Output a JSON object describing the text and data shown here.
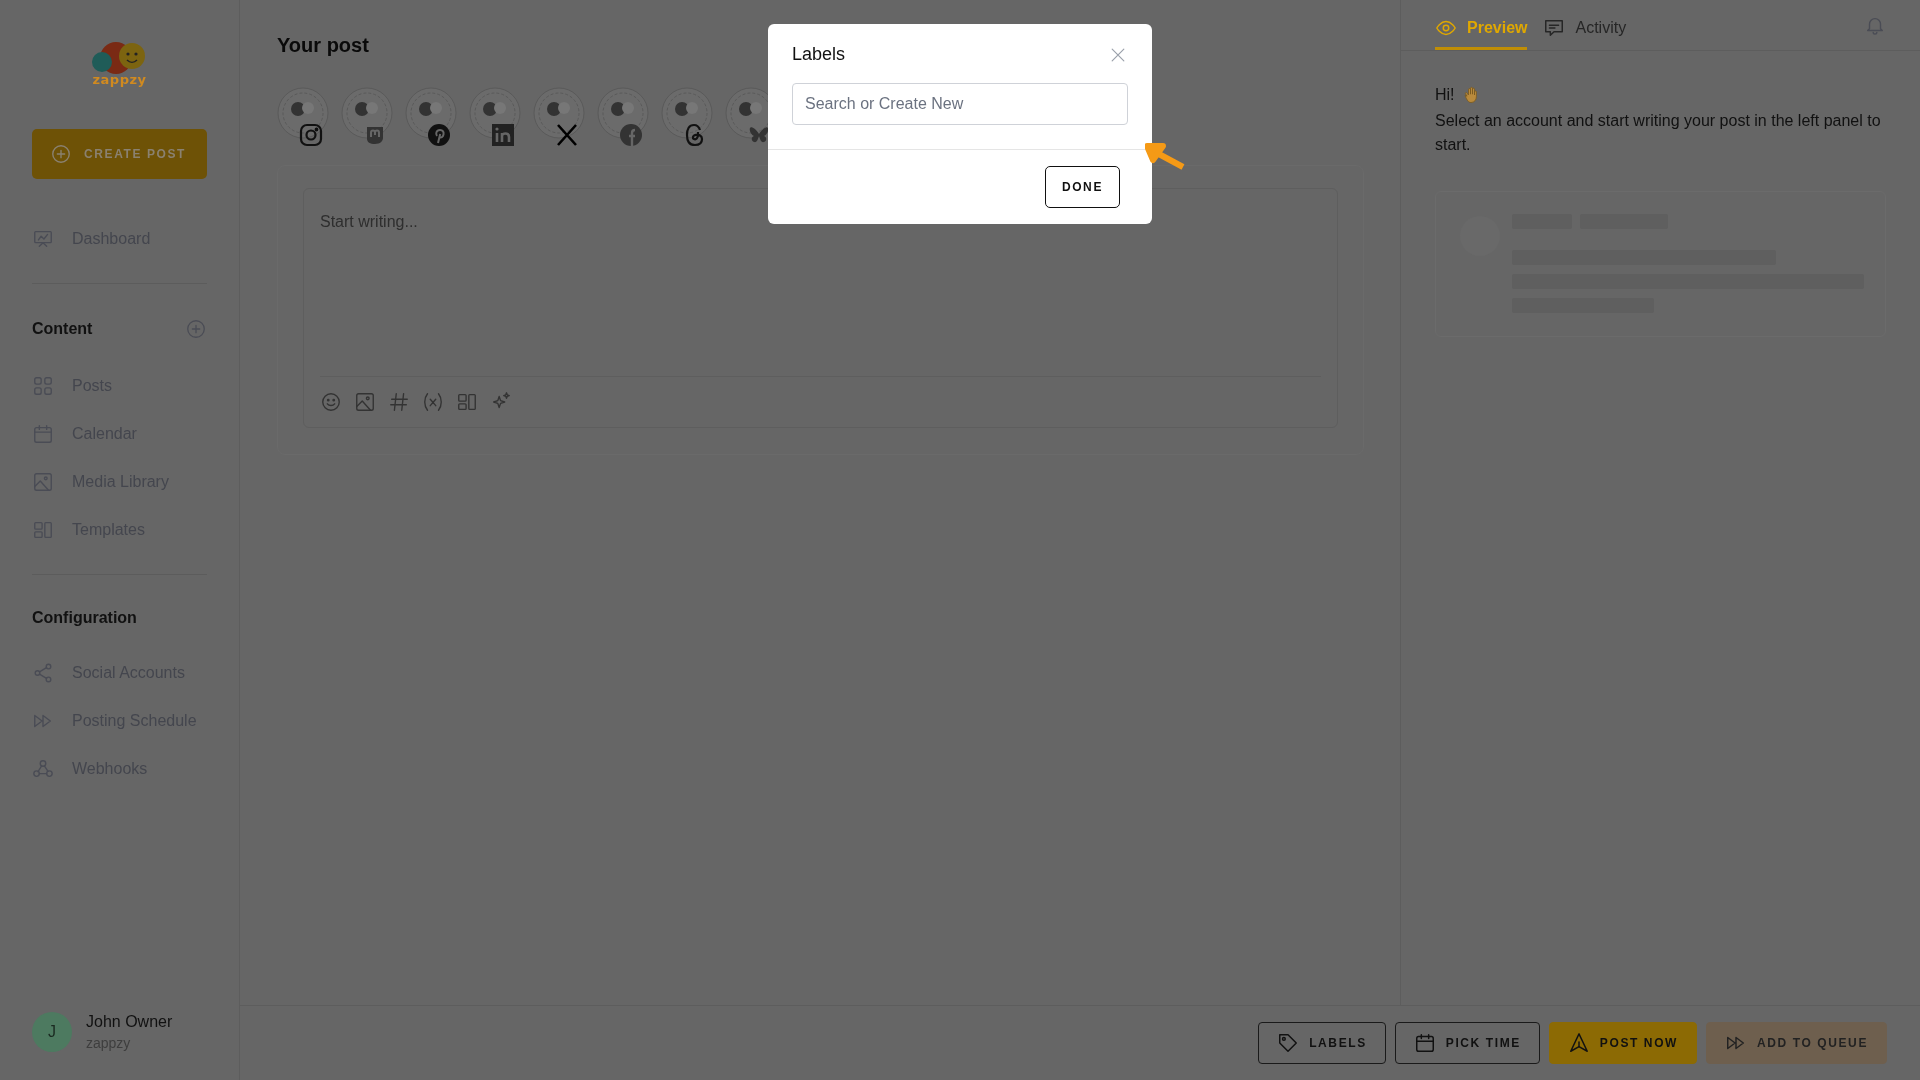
{
  "sidebar": {
    "logo_text": "zappzy",
    "create_button": "CREATE POST",
    "top_items": [
      {
        "label": "Dashboard"
      }
    ],
    "sections": [
      {
        "title": "Content",
        "add_button": true,
        "items": [
          {
            "label": "Posts"
          },
          {
            "label": "Calendar"
          },
          {
            "label": "Media Library"
          },
          {
            "label": "Templates"
          }
        ]
      },
      {
        "title": "Configuration",
        "add_button": false,
        "items": [
          {
            "label": "Social Accounts"
          },
          {
            "label": "Posting Schedule"
          },
          {
            "label": "Webhooks"
          }
        ]
      }
    ],
    "user": {
      "initial": "J",
      "name": "John Owner",
      "org": "zappzy"
    }
  },
  "editor": {
    "title": "Your post",
    "placeholder": "Start writing...",
    "accounts": [
      {
        "kind": "instagram"
      },
      {
        "kind": "mastodon"
      },
      {
        "kind": "pinterest"
      },
      {
        "kind": "linkedin"
      },
      {
        "kind": "x"
      },
      {
        "kind": "facebook"
      },
      {
        "kind": "threads"
      },
      {
        "kind": "bluesky"
      }
    ]
  },
  "preview": {
    "tabs": [
      {
        "label": "Preview",
        "selected": true
      },
      {
        "label": "Activity",
        "selected": false
      }
    ],
    "greeting": "Hi!",
    "message": "Select an account and start writing your post in the left panel to start."
  },
  "actions": [
    {
      "label": "LABELS",
      "kind": "outline"
    },
    {
      "label": "PICK TIME",
      "kind": "outline"
    },
    {
      "label": "POST NOW",
      "kind": "primary"
    },
    {
      "label": "ADD TO QUEUE",
      "kind": "secondary"
    }
  ],
  "modal": {
    "title": "Labels",
    "placeholder": "Search or Create New",
    "done": "DONE"
  }
}
